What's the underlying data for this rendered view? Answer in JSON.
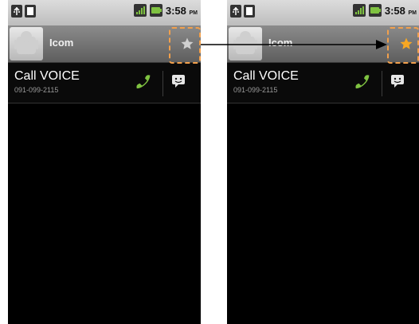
{
  "status_bar": {
    "time": "3:58",
    "ampm": "PM"
  },
  "left_screen": {
    "contact_name": "Icom",
    "star_state": "off",
    "call_row": {
      "label": "Call VOICE",
      "number": "091-099-2115"
    }
  },
  "right_screen": {
    "contact_name": "Icom",
    "star_state": "on",
    "call_row": {
      "label": "Call VOICE",
      "number": "091-099-2115"
    }
  },
  "colors": {
    "highlight": "#f2a04c",
    "star_off": "#d0d0d0",
    "star_on": "#f7a722",
    "phone_icon": "#7fc241",
    "arrow": "#000000"
  },
  "icons": {
    "star": "star-icon",
    "phone": "phone-icon",
    "sms": "sms-icon",
    "battery": "battery-icon",
    "signal": "signal-icon",
    "usb": "usb-icon",
    "sim": "sim-icon",
    "avatar": "contact-avatar-icon"
  }
}
